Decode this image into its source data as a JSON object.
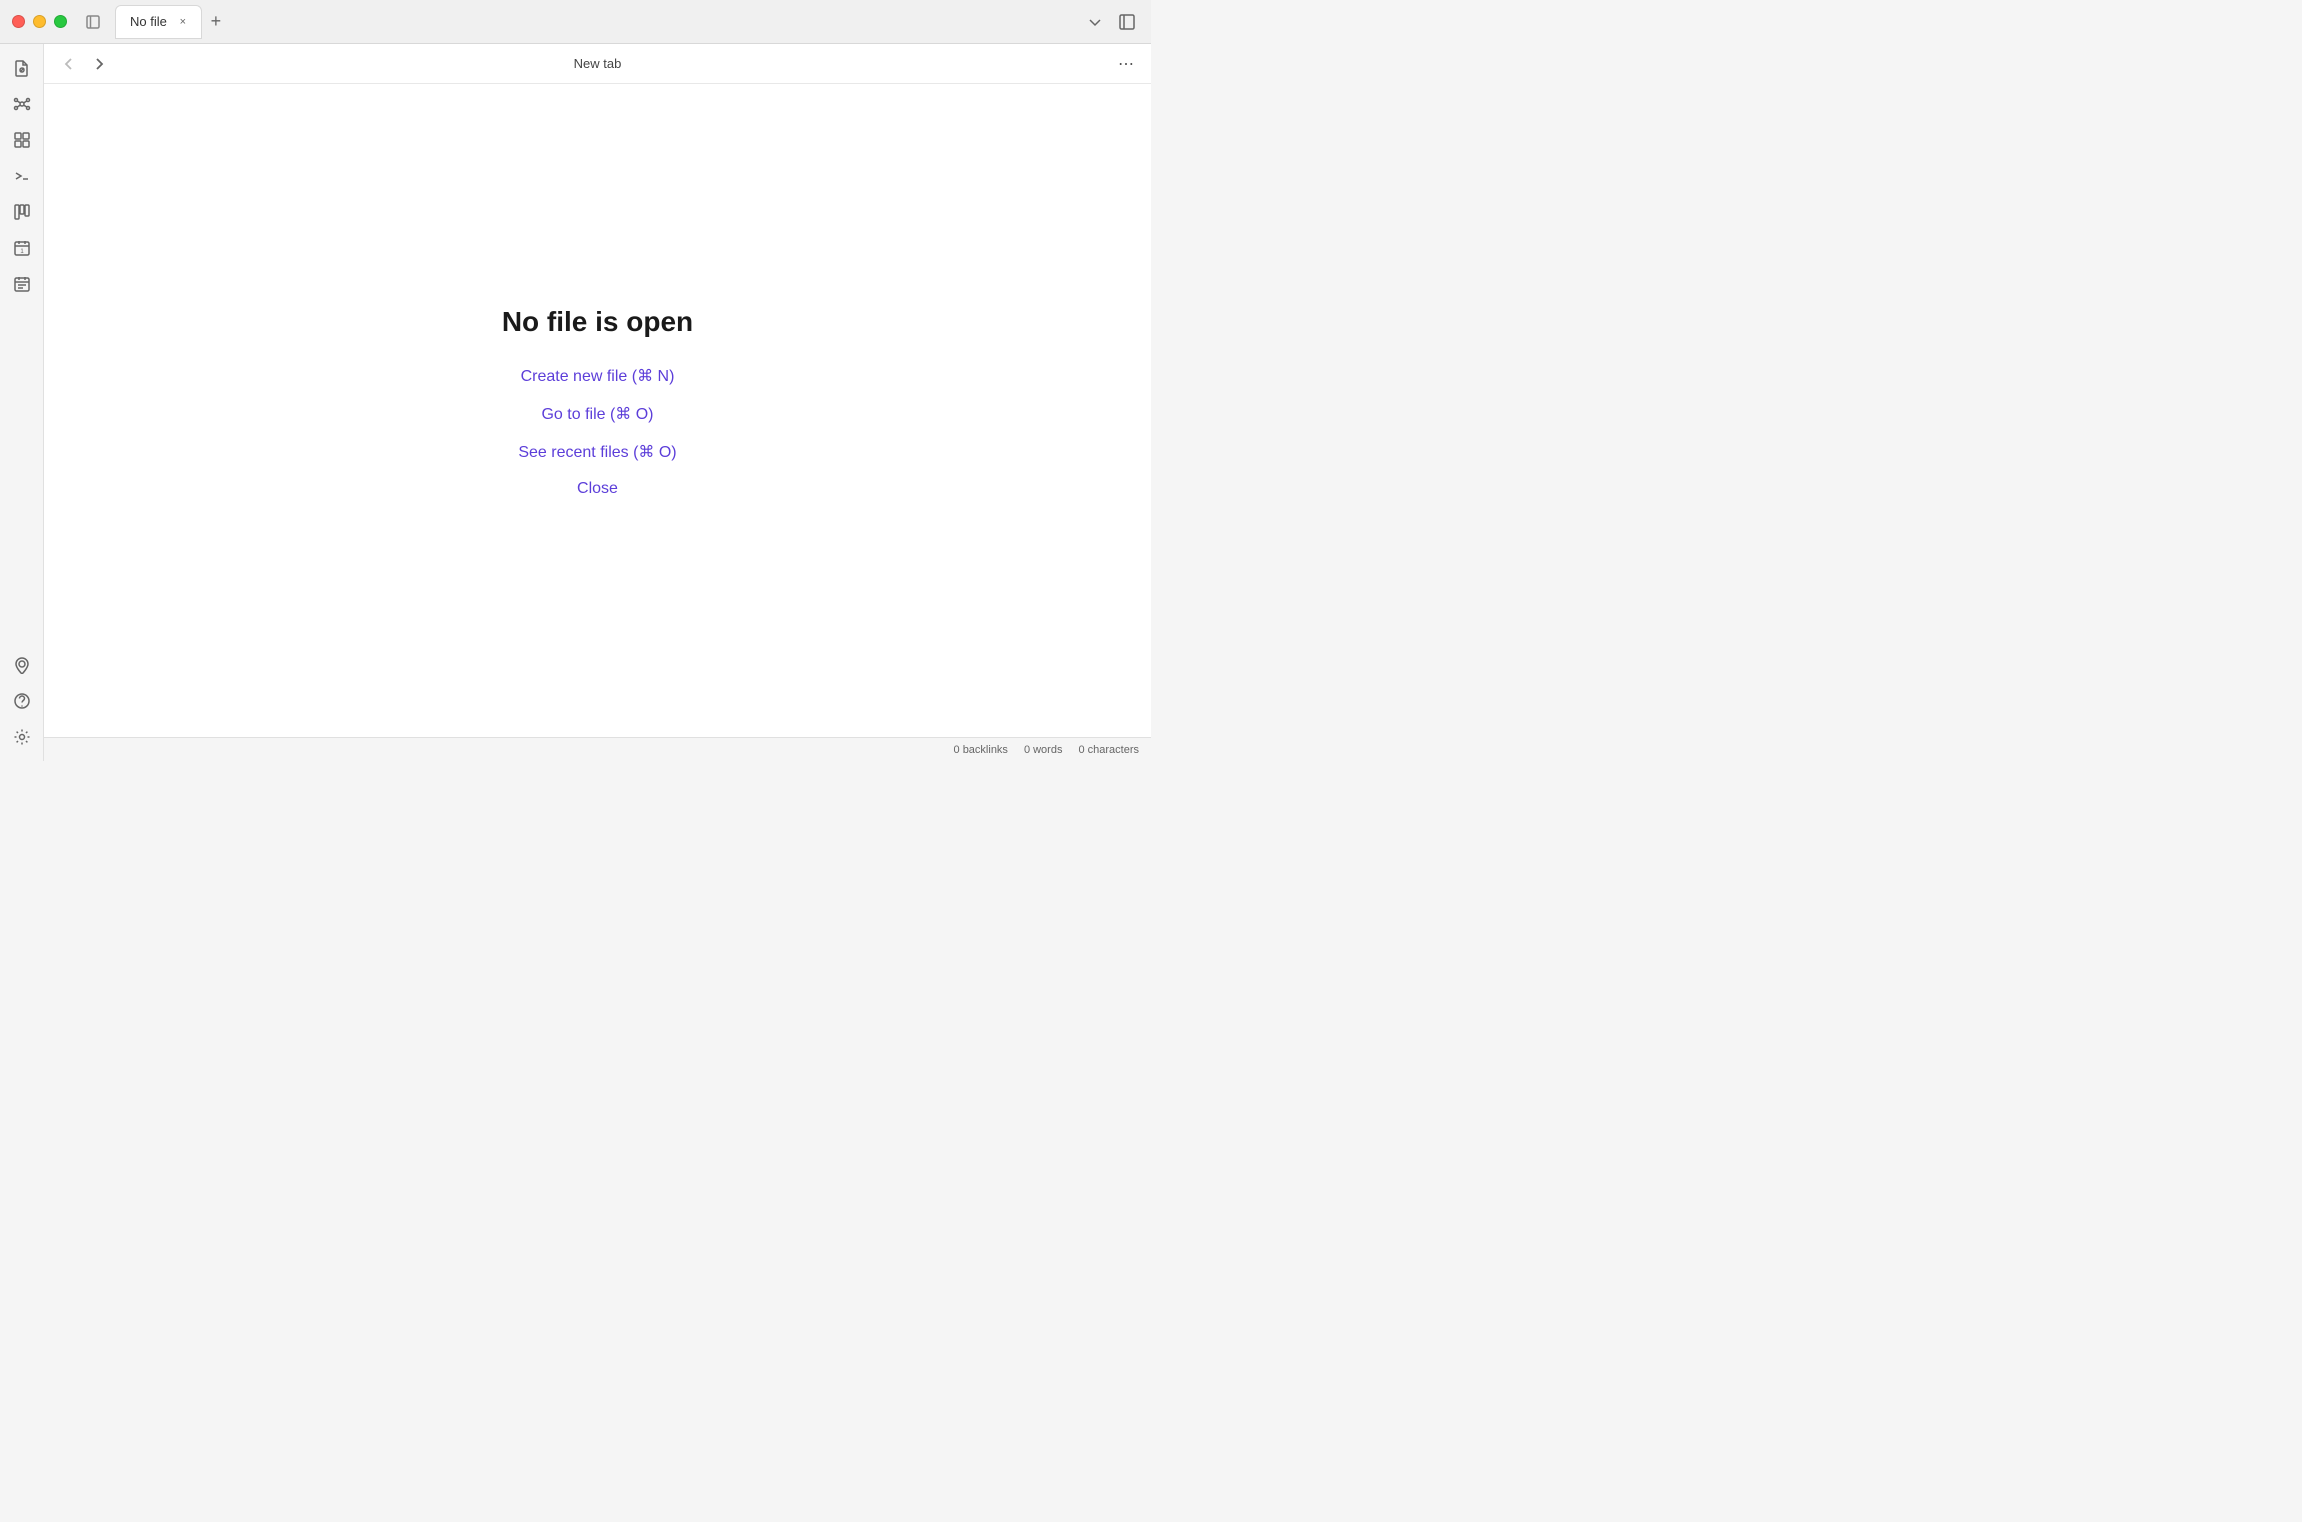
{
  "titlebar": {
    "tab_label": "No file",
    "new_tab_icon": "+",
    "close_icon": "×"
  },
  "toolbar": {
    "title": "New tab",
    "more_icon": "⋯"
  },
  "content": {
    "heading": "No file is open",
    "link_create": "Create new file (⌘ N)",
    "link_goto": "Go to file (⌘ O)",
    "link_recent": "See recent files (⌘ O)",
    "link_close": "Close"
  },
  "statusbar": {
    "backlinks": "0 backlinks",
    "words": "0 words",
    "characters": "0 characters"
  },
  "sidebar": {
    "items": [
      {
        "name": "files-icon",
        "label": "Files"
      },
      {
        "name": "graph-icon",
        "label": "Graph"
      },
      {
        "name": "extensions-icon",
        "label": "Extensions"
      },
      {
        "name": "terminal-icon",
        "label": "Terminal"
      },
      {
        "name": "kanban-icon",
        "label": "Kanban"
      },
      {
        "name": "calendar-day-icon",
        "label": "Day Calendar"
      },
      {
        "name": "calendar-icon",
        "label": "Calendar"
      }
    ],
    "bottom_items": [
      {
        "name": "map-icon",
        "label": "Map"
      },
      {
        "name": "help-icon",
        "label": "Help"
      },
      {
        "name": "settings-icon",
        "label": "Settings"
      }
    ]
  }
}
